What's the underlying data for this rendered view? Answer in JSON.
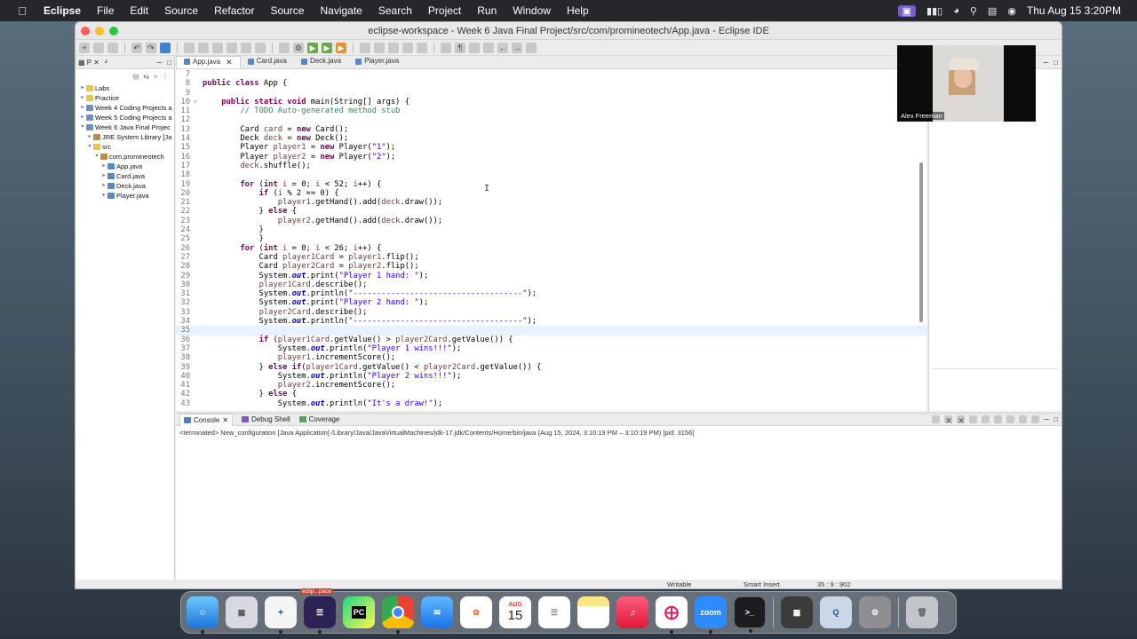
{
  "menubar": {
    "app_name": "Eclipse",
    "items": [
      "File",
      "Edit",
      "Source",
      "Refactor",
      "Source",
      "Navigate",
      "Search",
      "Project",
      "Run",
      "Window",
      "Help"
    ],
    "clock": "Thu Aug 15  3:20PM"
  },
  "window": {
    "title": "eclipse-workspace - Week 6 Java Final Project/src/com/promineotech/App.java - Eclipse IDE"
  },
  "explorer": {
    "tab_label": "P",
    "tab2_label": "²",
    "items": [
      {
        "label": "Labs",
        "indent": 0,
        "icon": "folder",
        "arrow": "▸"
      },
      {
        "label": "Practice",
        "indent": 0,
        "icon": "folder",
        "arrow": "▸"
      },
      {
        "label": "Week 4 Coding Projects a",
        "indent": 0,
        "icon": "proj",
        "arrow": "▸"
      },
      {
        "label": "Week 5 Coding Projects a",
        "indent": 0,
        "icon": "proj",
        "arrow": "▸"
      },
      {
        "label": "Week 6 Java Final Projec",
        "indent": 0,
        "icon": "proj",
        "arrow": "▾"
      },
      {
        "label": "JRE System Library [Ja",
        "indent": 1,
        "icon": "lib",
        "arrow": "▸"
      },
      {
        "label": "src",
        "indent": 1,
        "icon": "folder",
        "arrow": "▾"
      },
      {
        "label": "com.promineotech",
        "indent": 2,
        "icon": "pkg",
        "arrow": "▾"
      },
      {
        "label": "App.java",
        "indent": 3,
        "icon": "java",
        "arrow": "▸"
      },
      {
        "label": "Card.java",
        "indent": 3,
        "icon": "java",
        "arrow": "▸"
      },
      {
        "label": "Deck.java",
        "indent": 3,
        "icon": "java",
        "arrow": "▸"
      },
      {
        "label": "Player.java",
        "indent": 3,
        "icon": "java",
        "arrow": "▸"
      }
    ]
  },
  "editor": {
    "tabs": [
      {
        "label": "App.java",
        "active": true
      },
      {
        "label": "Card.java",
        "active": false
      },
      {
        "label": "Deck.java",
        "active": false
      },
      {
        "label": "Player.java",
        "active": false
      }
    ],
    "lines": [
      {
        "n": "7",
        "g": "",
        "html": ""
      },
      {
        "n": "8",
        "g": "",
        "html": "<span class='kw'>public class</span> App {"
      },
      {
        "n": "9",
        "g": "",
        "html": ""
      },
      {
        "n": "10",
        "g": "⊖",
        "html": "    <span class='kw'>public static void</span> main(String[] args) {"
      },
      {
        "n": "11",
        "g": "",
        "html": "        <span class='cm'>// TODO Auto-generated method stub</span>"
      },
      {
        "n": "12",
        "g": "",
        "html": ""
      },
      {
        "n": "13",
        "g": "",
        "html": "        Card <span class='var'>card</span> = <span class='kw'>new</span> Card();"
      },
      {
        "n": "14",
        "g": "",
        "html": "        Deck <span class='var'>deck</span> = <span class='kw'>new</span> Deck();"
      },
      {
        "n": "15",
        "g": "",
        "html": "        Player <span class='var'>player1</span> = <span class='kw'>new</span> Player(<span class='st'>\"1\"</span>);"
      },
      {
        "n": "16",
        "g": "",
        "html": "        Player <span class='var'>player2</span> = <span class='kw'>new</span> Player(<span class='st'>\"2\"</span>);"
      },
      {
        "n": "17",
        "g": "",
        "html": "        <span class='var'>deck</span>.shuffle();"
      },
      {
        "n": "18",
        "g": "",
        "html": ""
      },
      {
        "n": "19",
        "g": "",
        "html": "        <span class='kw'>for</span> (<span class='kw'>int</span> <span class='var'>i</span> = 0; <span class='var'>i</span> &lt; 52; <span class='var'>i</span>++) {"
      },
      {
        "n": "20",
        "g": "",
        "html": "            <span class='kw'>if</span> (<span class='var'>i</span> % 2 == 0) {"
      },
      {
        "n": "21",
        "g": "",
        "html": "                <span class='var'>player1</span>.getHand().add(<span class='var'>deck</span>.draw());"
      },
      {
        "n": "22",
        "g": "",
        "html": "            } <span class='kw'>else</span> {"
      },
      {
        "n": "23",
        "g": "",
        "html": "                <span class='var'>player2</span>.getHand().add(<span class='var'>deck</span>.draw());"
      },
      {
        "n": "24",
        "g": "",
        "html": "            }"
      },
      {
        "n": "25",
        "g": "",
        "html": "            }"
      },
      {
        "n": "26",
        "g": "",
        "html": "        <span class='kw'>for</span> (<span class='kw'>int</span> <span class='var'>i</span> = 0; <span class='var'>i</span> &lt; 26; <span class='var'>i</span>++) {"
      },
      {
        "n": "27",
        "g": "",
        "html": "            Card <span class='var'>player1Card</span> = <span class='var'>player1</span>.flip();"
      },
      {
        "n": "28",
        "g": "",
        "html": "            Card <span class='var'>player2Card</span> = <span class='var'>player2</span>.flip();"
      },
      {
        "n": "29",
        "g": "",
        "html": "            System.<span class='fld'>out</span>.print(<span class='st'>\"Player 1 hand: \"</span>);"
      },
      {
        "n": "30",
        "g": "",
        "html": "            <span class='var'>player1Card</span>.describe();"
      },
      {
        "n": "31",
        "g": "",
        "html": "            System.<span class='fld'>out</span>.println(<span class='st'>\"------------------------------------\"</span>);"
      },
      {
        "n": "32",
        "g": "",
        "html": "            System.<span class='fld'>out</span>.print(<span class='st'>\"Player 2 hand: \"</span>);"
      },
      {
        "n": "33",
        "g": "",
        "html": "            <span class='var'>player2Card</span>.describe();"
      },
      {
        "n": "34",
        "g": "",
        "html": "            System.<span class='fld'>out</span>.println(<span class='st'>\"------------------------------------\"</span>);"
      },
      {
        "n": "35",
        "g": "",
        "html": "",
        "current": true
      },
      {
        "n": "36",
        "g": "",
        "html": "            <span class='kw'>if</span> (<span class='var'>player1Card</span>.getValue() &gt; <span class='var'>player2Card</span>.getValue()) {"
      },
      {
        "n": "37",
        "g": "",
        "html": "                System.<span class='fld'>out</span>.println(<span class='st'>\"Player 1 wins!!!\"</span>);"
      },
      {
        "n": "38",
        "g": "",
        "html": "                <span class='var'>player1</span>.incrementScore();"
      },
      {
        "n": "39",
        "g": "",
        "html": "            } <span class='kw'>else if</span>(<span class='var'>player1Card</span>.getValue() &lt; <span class='var'>player2Card</span>.getValue()) {"
      },
      {
        "n": "40",
        "g": "",
        "html": "                System.<span class='fld'>out</span>.println(<span class='st'>\"Player 2 wins!!!\"</span>);"
      },
      {
        "n": "41",
        "g": "",
        "html": "                <span class='var'>player2</span>.incrementScore();"
      },
      {
        "n": "42",
        "g": "",
        "html": "            } <span class='kw'>else</span> {"
      },
      {
        "n": "43",
        "g": "",
        "html": "                System.<span class='fld'>out</span>.println(<span class='st'>\"It's a draw!\"</span>);"
      }
    ]
  },
  "webcam": {
    "name": "Alex Freeman"
  },
  "console": {
    "tabs": [
      {
        "label": "Console",
        "icon": "console"
      },
      {
        "label": "Debug Shell",
        "icon": "debug"
      },
      {
        "label": "Coverage",
        "icon": "cov"
      }
    ],
    "terminated_text": "<terminated> New_configuration [Java Application] /Library/Java/JavaVirtualMachines/jdk-17.jdk/Contents/Home/bin/java  (Aug 15, 2024, 3:10:19 PM – 3:10:19 PM) [pid: 3156]"
  },
  "statusbar": {
    "writable": "Writable",
    "insert_mode": "Smart Insert",
    "position": "35 : 9 : 902"
  },
  "dock": {
    "eclipse_label": "eclip...pace",
    "calendar_month": "AUG",
    "calendar_day": "15",
    "zoom_label": "zoom",
    "pycharm_label": "PC"
  }
}
